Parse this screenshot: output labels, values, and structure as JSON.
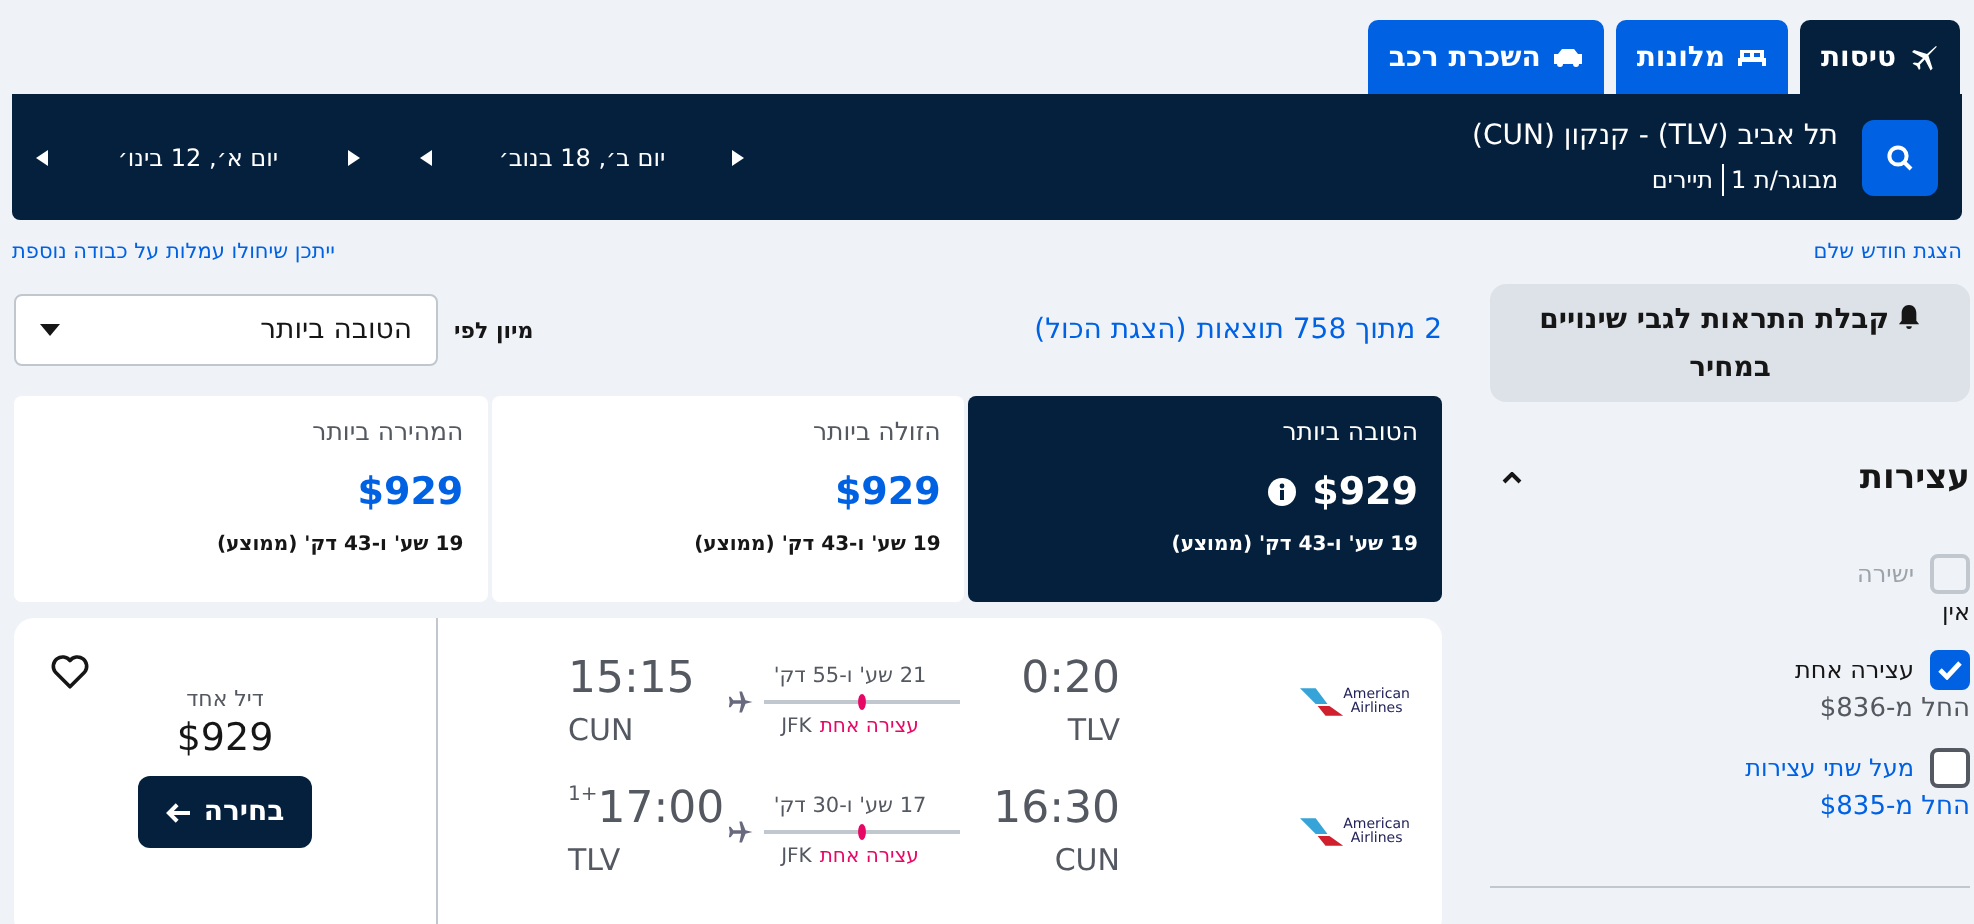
{
  "tabs": [
    {
      "label": "טיסות",
      "kind": "plane",
      "selected": true
    },
    {
      "label": "מלונות",
      "kind": "bed",
      "selected": false
    },
    {
      "label": "השכרת רכב",
      "kind": "car",
      "selected": false
    }
  ],
  "search": {
    "route": "תל אביב (TLV) - קנקון (CUN)",
    "travelers": "מבוגר/ת 1",
    "cabin": "תיירים",
    "dates": [
      "יום ב׳, 18 בנוב׳",
      "יום א׳, 12 בינו׳"
    ]
  },
  "links": {
    "month": "הצגת חודש שלם",
    "fees": "ייתכן שיחולו עמלות על כבודה נוספת"
  },
  "sidebar": {
    "alert": "קבלת התראות לגבי שינויים במחיר",
    "filter_title": "עצירות",
    "expanded": true,
    "options": [
      {
        "label": "ישירה",
        "price": "אין",
        "checked": false,
        "disabled": true
      },
      {
        "label": "עצירה אחת",
        "price": "החל מ-$836",
        "checked": true,
        "disabled": false
      },
      {
        "label": "מעל שתי עצירות",
        "price": "החל מ-$835",
        "checked": false,
        "disabled": false
      }
    ]
  },
  "results": {
    "count": "2 מתוך 758 תוצאות",
    "show_all": "(הצגת הכול)",
    "sort_label": "מיון לפי",
    "sort_value": "הטובה ביותר"
  },
  "summary_cards": [
    {
      "title": "הטובה ביותר",
      "price": "$929",
      "duration": "19 שע' ו-43 דק' (ממוצע)",
      "info": true,
      "selected": true
    },
    {
      "title": "הזולה ביותר",
      "price": "$929",
      "duration": "19 שע' ו-43 דק' (ממוצע)",
      "info": false,
      "selected": false
    },
    {
      "title": "המהירה ביותר",
      "price": "$929",
      "duration": "19 שע' ו-43 דק' (ממוצע)",
      "info": false,
      "selected": false
    }
  ],
  "flight": {
    "favorite": false,
    "deals": "דיל אחד",
    "price": "$929",
    "select": "בחירה",
    "legs": [
      {
        "airline": "American Airlines",
        "depart": "0:20",
        "from": "TLV",
        "arrive": "15:15",
        "to": "CUN",
        "duration": "21 שע' ו-55 דק'",
        "stops": "עצירה אחת",
        "via": "JFK"
      },
      {
        "airline": "American Airlines",
        "depart": "16:30",
        "from": "CUN",
        "arrive": "17:00",
        "day_offset": "+1",
        "to": "TLV",
        "duration": "17 שע' ו-30 דק'",
        "stops": "עצירה אחת",
        "via": "JFK"
      }
    ]
  }
}
